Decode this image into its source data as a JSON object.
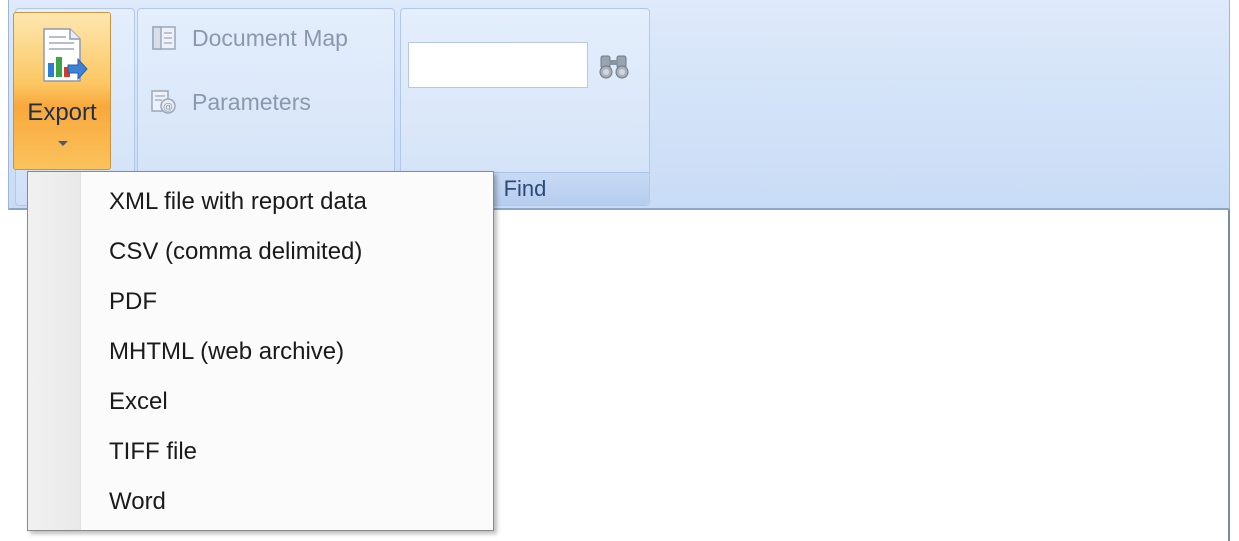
{
  "ribbon": {
    "export_button": {
      "label": "Export",
      "icon": "export-report-icon"
    },
    "document_map": {
      "label": "Document Map",
      "icon": "document-map-icon",
      "enabled": false
    },
    "parameters": {
      "label": "Parameters",
      "icon": "parameters-icon",
      "enabled": false
    },
    "find_group": {
      "label": "Find",
      "search_value": "",
      "search_placeholder": "",
      "search_icon": "binoculars-icon"
    },
    "colors": {
      "ribbon_background": "#d5e4f8",
      "export_active": "#f8a83c",
      "disabled_text": "#8a98ad"
    }
  },
  "export_menu": {
    "items": [
      {
        "label": "XML file with report data"
      },
      {
        "label": "CSV (comma delimited)"
      },
      {
        "label": "PDF"
      },
      {
        "label": "MHTML (web archive)"
      },
      {
        "label": "Excel"
      },
      {
        "label": "TIFF file"
      },
      {
        "label": "Word"
      }
    ]
  }
}
